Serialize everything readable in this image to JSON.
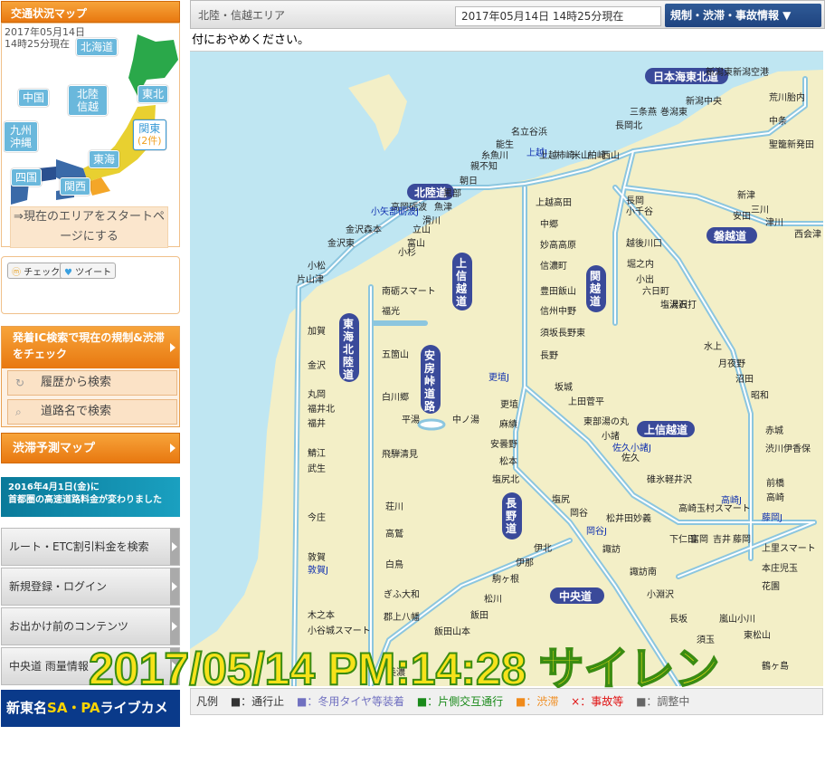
{
  "sidebar": {
    "map_title": "交通状況マップ",
    "datetime_line1": "2017年05月14日",
    "datetime_line2": "14時25分現在",
    "regions": {
      "hokkaido": "北海道",
      "chugoku": "中国",
      "hokuriku": "北陸信越",
      "tohoku": "東北",
      "kyushu": "九州沖縄",
      "kanto": "関東",
      "kanto_count": "(2件)",
      "tokai": "東海",
      "shikoku": "四国",
      "kansai": "関西"
    },
    "start_link": "⇒現在のエリアをスタートページにする",
    "check_btn": "チェック",
    "tweet_btn": "ツイート",
    "ic_search_title": "発着IC検索で現在の規制&渋滞をチェック",
    "history_search": "履歴から検索",
    "road_search": "道路名で検索",
    "jam_forecast": "渋滞予測マップ",
    "banner_line1": "2016年4月1日(金)に",
    "banner_line2": "首都圏の高速道路料金が変わりました",
    "menu": [
      "ルート・ETC割引料金を検索",
      "新規登録・ログイン",
      "お出かけ前のコンテンツ",
      "中央道 雨量情報"
    ],
    "livecam_pre": "新東名",
    "livecam_sapa": "SA・PA",
    "livecam_post": "ライブカメラ"
  },
  "header": {
    "area_name": "北陸・信越エリア",
    "datetime": "2017年05月14日 14時25分現在",
    "info_dropdown": "規制・渋滞・事故情報 ▼"
  },
  "ticker": "付におやめください。",
  "overlay": "2017/05/14 PM:14:28 サイレン",
  "legend": {
    "label": "凡例",
    "items": [
      "■：通行止",
      "■：冬用タイヤ等装着",
      "■：片側交互通行",
      "■：渋滞",
      "×：事故等",
      "■：調整中"
    ]
  },
  "legend_colors": [
    "#111111",
    "#9090e0",
    "#1a8a1a",
    "#f08a1a",
    "#e01010",
    "#666666"
  ],
  "map": {
    "roads": [
      "日本海東北道",
      "北陸道",
      "上信越道",
      "関越道",
      "東海北陸道",
      "安房峠道路",
      "上信越道",
      "磐越道",
      "長野道",
      "中央道"
    ],
    "labels": [
      "新潟空港",
      "新潟東スマート",
      "新潟亀田",
      "新潟中央",
      "新津",
      "安田",
      "三川",
      "津川",
      "荒川胎内",
      "中条",
      "聖籠新発田",
      "豊栄新新潟東",
      "黒埼",
      "巻潟東",
      "三条燕",
      "中之島見附",
      "長岡北スマート",
      "栄",
      "上越",
      "能生",
      "名立谷浜",
      "糸魚川",
      "朝日",
      "親不知",
      "黒部",
      "魚津",
      "滑川",
      "立山",
      "富山",
      "小杉",
      "高岡砺波スマート",
      "砺波",
      "福光",
      "小矢部砺波J",
      "金沢森本",
      "小松",
      "片山津",
      "加賀",
      "丸岡",
      "福井北",
      "福井",
      "鯖江",
      "武生",
      "今庄",
      "敦賀",
      "敦賀J",
      "若狭美浜",
      "若狭上中",
      "上越高田",
      "中郷",
      "妙高高原",
      "信濃町",
      "豊田飯山",
      "信州中野",
      "須坂長野東",
      "長野",
      "坂城",
      "更埴J",
      "更埴",
      "上田菅平",
      "東部湯の丸",
      "小諸",
      "佐久小諸J",
      "佐久",
      "碓氷軽井沢",
      "藤岡J",
      "高崎J",
      "高崎玉村スマート",
      "麻績",
      "安曇野",
      "松本",
      "塩尻北",
      "塩尻",
      "岡谷",
      "岡谷J",
      "諏訪",
      "伊北",
      "伊那",
      "駒ヶ根",
      "松川",
      "飯田",
      "飯田山本",
      "園原",
      "中津川",
      "郡上八幡",
      "ぎふ大和",
      "白鳥",
      "高鷲",
      "荘川",
      "飛騨清見",
      "白川郷",
      "五箇山",
      "福光",
      "南砺スマート",
      "平湯",
      "中ノ湯",
      "長岡",
      "長岡南越路スマート",
      "小千谷",
      "越後川口",
      "堀之内",
      "小出",
      "六日町",
      "塩沢石打",
      "湯沢",
      "水上",
      "月夜野",
      "沼田",
      "昭和",
      "赤城",
      "渋川伊香保",
      "前橋",
      "高崎",
      "本庄児玉",
      "上里スマート",
      "花園",
      "嵐山小川",
      "東松山",
      "須玉",
      "長坂",
      "小淵沢",
      "松井田妙義",
      "下仁田",
      "富岡",
      "吉井",
      "藤岡",
      "新潟中央J",
      "長岡J",
      "佐久",
      "木之本",
      "小谷城スマート",
      "長浜",
      "米原",
      "西会津",
      "長坂",
      "駒ヶ岳"
    ]
  }
}
